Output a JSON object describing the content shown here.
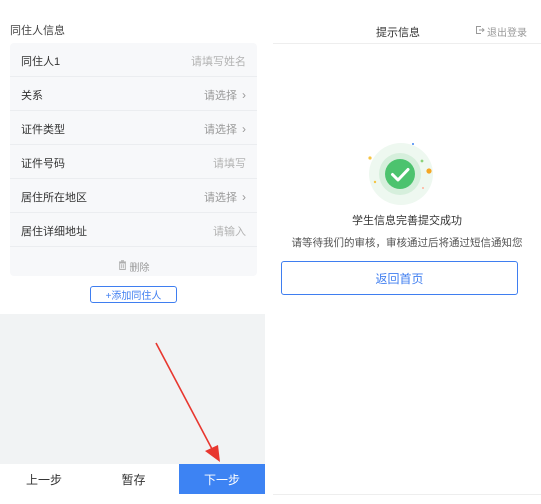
{
  "left": {
    "section_title": "同住人信息",
    "rows": [
      {
        "label": "同住人1",
        "value": "请填写姓名",
        "type": "input"
      },
      {
        "label": "关系",
        "value": "请选择",
        "type": "select"
      },
      {
        "label": "证件类型",
        "value": "请选择",
        "type": "select"
      },
      {
        "label": "证件号码",
        "value": "请填写",
        "type": "input"
      },
      {
        "label": "居住所在地区",
        "value": "请选择",
        "type": "select"
      },
      {
        "label": "居住详细地址",
        "value": "请输入",
        "type": "input"
      }
    ],
    "delete_label": "删除",
    "add_label": "+添加同住人",
    "bottom_bar": {
      "prev_label": "上一步",
      "save_label": "暂存",
      "next_label": "下一步"
    }
  },
  "right": {
    "title": "提示信息",
    "logout_label": "退出登录",
    "success_title": "学生信息完善提交成功",
    "success_desc": "请等待我们的审核，审核通过后将通过短信通知您",
    "home_label": "返回首页"
  },
  "colors": {
    "accent": "#3d83f3",
    "success": "#4cc36e",
    "arrow": "#e8372f"
  },
  "icons": [
    "chevron-right-icon",
    "trash-icon",
    "logout-icon",
    "success-check-icon",
    "red-arrow-annotation"
  ]
}
